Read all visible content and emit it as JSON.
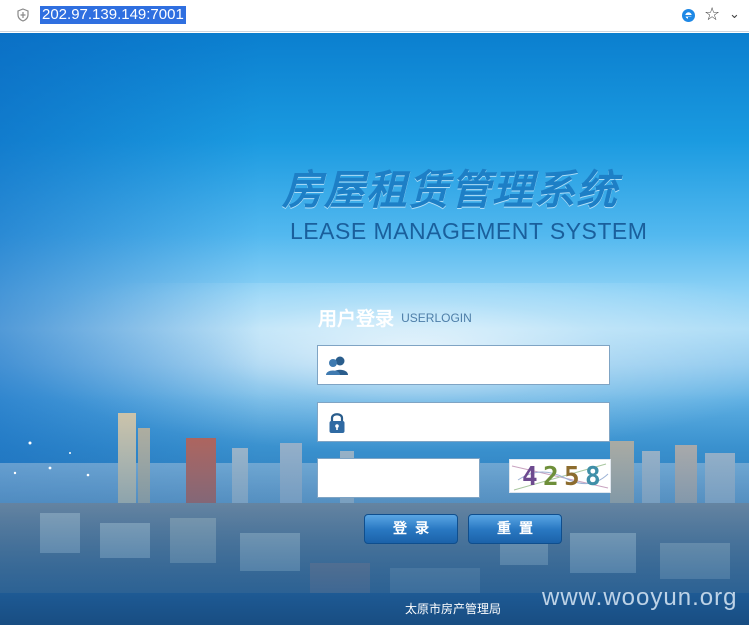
{
  "browser": {
    "url": "202.97.139.149:7001",
    "icons": [
      "security-shield-icon",
      "ie-compat-icon",
      "favorite-star-icon",
      "dropdown-chevron-icon"
    ],
    "star_glyph": "☆",
    "chevron_glyph": "⌄"
  },
  "page": {
    "title_cn": "房屋租赁管理系统",
    "title_en": "LEASE MANAGEMENT SYSTEM",
    "login_title_cn": "用户登录",
    "login_title_en": "USERLOGIN",
    "username": {
      "value": "",
      "placeholder": "",
      "icon": "user-icon"
    },
    "password": {
      "value": "",
      "placeholder": "",
      "icon": "lock-icon"
    },
    "captcha_input": {
      "value": "",
      "placeholder": ""
    },
    "captcha_code": "4258",
    "login_button": "登录",
    "reset_button": "重置",
    "footer": "太原市房产管理局",
    "watermark": "www.wooyun.org"
  },
  "colors": {
    "accent": "#1d7fc6",
    "url_highlight": "#2f6fe0",
    "button": "#2a79c3"
  }
}
